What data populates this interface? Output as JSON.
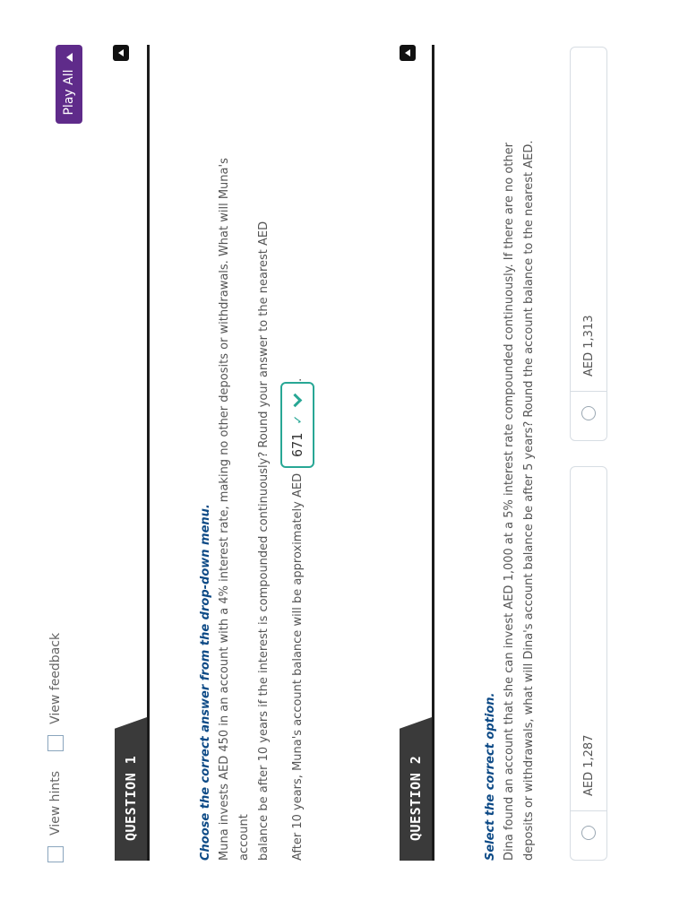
{
  "controls": {
    "view_hints_label": "View hints",
    "view_feedback_label": "View feedback",
    "play_all_label": "Play All"
  },
  "questions": [
    {
      "tag": "QUESTION 1",
      "instruction": "Choose the correct answer from the drop-down menu.",
      "text_line1": "Muna invests AED 450 in an account with a 4% interest rate, making no other deposits or withdrawals. What will Muna's account",
      "text_line2": "balance be after 10 years if the interest is compounded continuously? Round your answer to the nearest AED",
      "answer_prefix": "After 10 years, Muna's account balance will be approximately AED",
      "dropdown_value": "671",
      "answer_suffix": "."
    },
    {
      "tag": "QUESTION 2",
      "instruction": "Select the correct option.",
      "text_line1": "Dina found an account that she can invest AED 1,000 at a 5% interest rate compounded continuously. If there are no other",
      "text_line2": "deposits or withdrawals, what will Dina's account balance be after 5 years? Round the account balance to the nearest AED.",
      "options": [
        "AED 1,287",
        "AED 1,313"
      ]
    }
  ]
}
